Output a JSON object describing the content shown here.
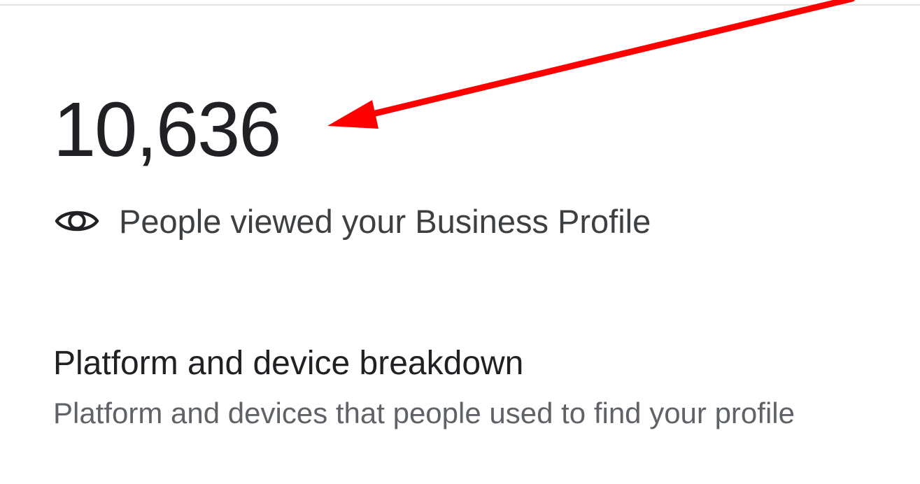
{
  "metric": {
    "value": "10,636",
    "caption": "People viewed your Business Profile",
    "icon": "eye-icon"
  },
  "section": {
    "title": "Platform and device breakdown",
    "subtitle": "Platform and devices that people used to find your profile"
  },
  "annotation": {
    "arrow_color": "#ff0000"
  },
  "colors": {
    "primary_text": "#202124",
    "secondary_text": "#5f6368",
    "divider": "#e2e3e5"
  }
}
